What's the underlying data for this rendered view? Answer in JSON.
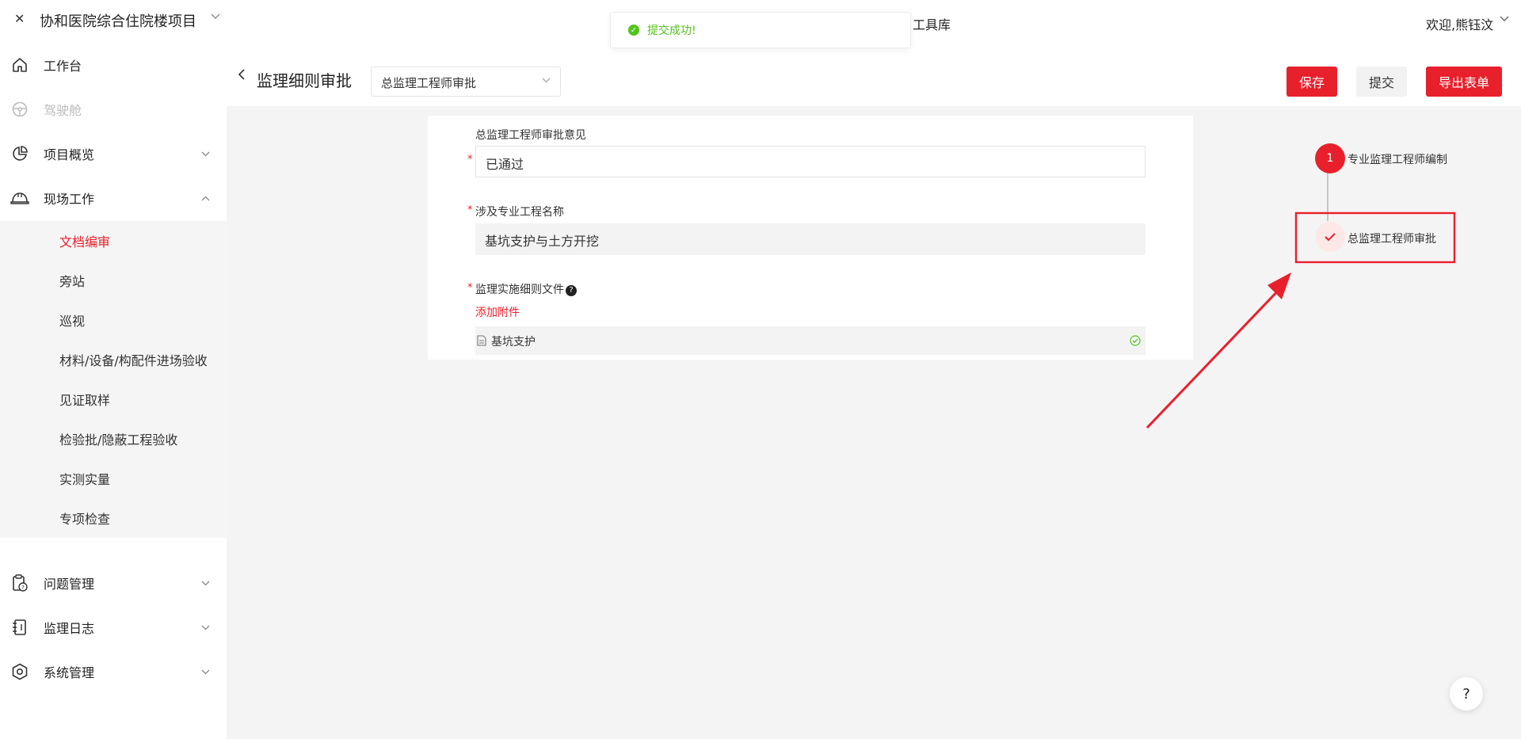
{
  "topbar": {
    "project_name": "协和医院综合住院楼项目",
    "toolbox_label": "工具库",
    "welcome_text": "欢迎,熊钰汶"
  },
  "toast": {
    "message": "提交成功!",
    "color": "#52c41a"
  },
  "sidebar": {
    "items": [
      {
        "label": "工作台",
        "icon": "home-icon"
      },
      {
        "label": "驾驶舱",
        "icon": "steering-wheel-icon",
        "disabled": true
      },
      {
        "label": "项目概览",
        "icon": "pie-chart-icon"
      },
      {
        "label": "现场工作",
        "icon": "helmet-icon"
      },
      {
        "label": "问题管理",
        "icon": "clipboard-question-icon"
      },
      {
        "label": "监理日志",
        "icon": "notebook-icon"
      },
      {
        "label": "系统管理",
        "icon": "settings-icon"
      }
    ],
    "submenu": [
      {
        "label": "文档编审",
        "active": true
      },
      {
        "label": "旁站"
      },
      {
        "label": "巡视"
      },
      {
        "label": "材料/设备/构配件进场验收"
      },
      {
        "label": "见证取样"
      },
      {
        "label": "检验批/隐蔽工程验收"
      },
      {
        "label": "实测实量"
      },
      {
        "label": "专项检查"
      }
    ]
  },
  "header": {
    "title": "监理细则审批",
    "stage_select_value": "总监理工程师审批",
    "save_label": "保存",
    "submit_label": "提交",
    "export_label": "导出表单"
  },
  "form": {
    "opinion_label": "总监理工程师审批意见",
    "opinion_value": "已通过",
    "project_label": "涉及专业工程名称",
    "project_value": "基坑支护与土方开挖",
    "file_label": "监理实施细则文件",
    "add_attachment": "添加附件",
    "file_name": "基坑支护"
  },
  "steps": [
    {
      "index": "1",
      "label": "专业监理工程师编制"
    },
    {
      "label": "总监理工程师审批",
      "status": "done"
    }
  ],
  "colors": {
    "brand_red": "#e8202b",
    "success_green": "#52c41a"
  }
}
